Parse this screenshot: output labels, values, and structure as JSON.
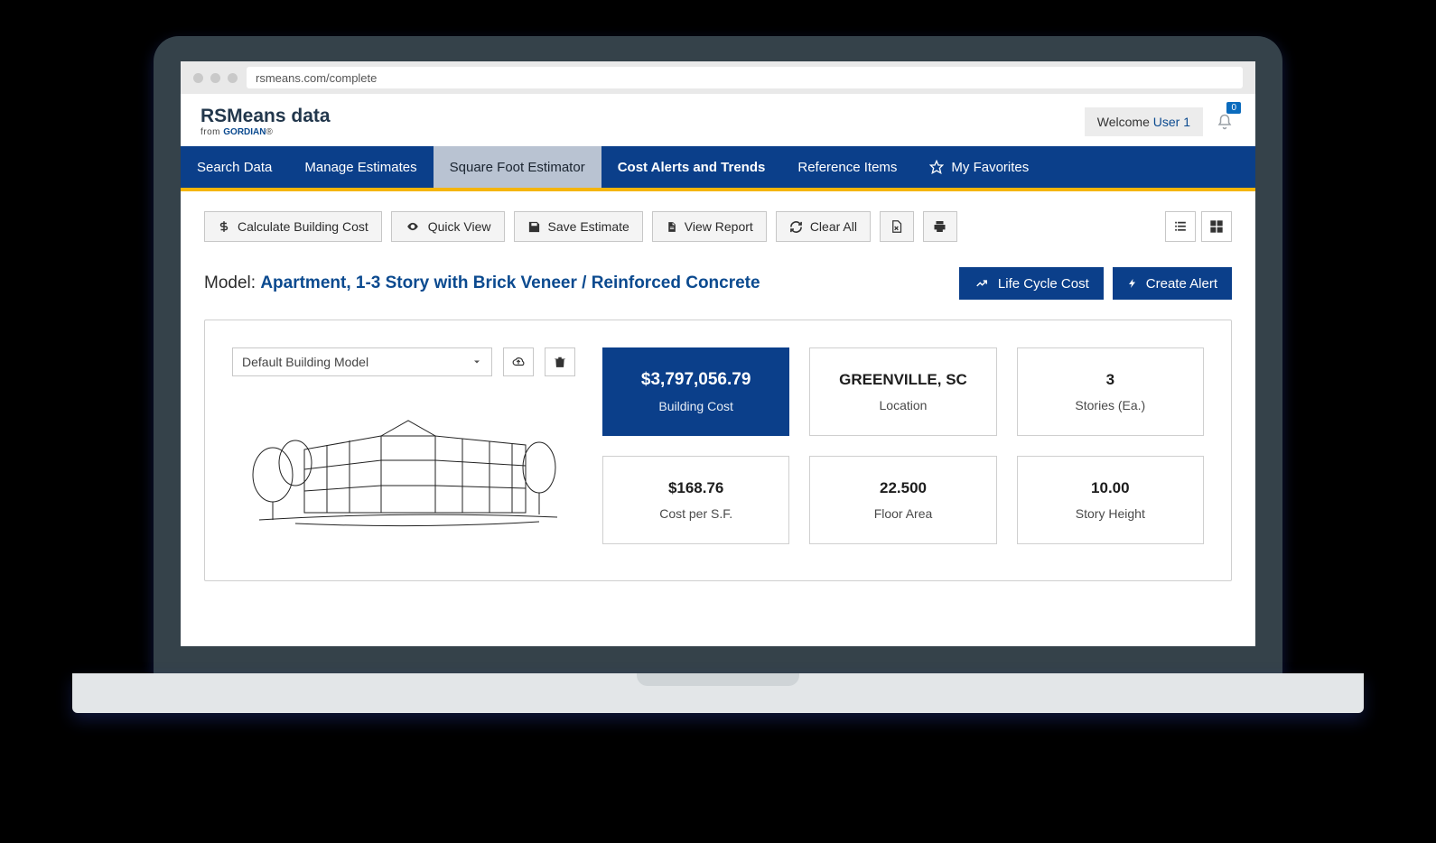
{
  "browser": {
    "url": "rsmeans.com/complete"
  },
  "header": {
    "logo_main": "RSMeans data",
    "logo_from": "from ",
    "logo_brand": "GORDIAN",
    "welcome": "Welcome ",
    "user": "User 1",
    "notifications": "0"
  },
  "nav": {
    "items": [
      {
        "label": "Search Data"
      },
      {
        "label": "Manage Estimates"
      },
      {
        "label": "Square Foot Estimator"
      },
      {
        "label": "Cost Alerts and Trends"
      },
      {
        "label": "Reference Items"
      },
      {
        "label": "My Favorites"
      }
    ]
  },
  "toolbar": {
    "calculate": "Calculate Building Cost",
    "quickview": "Quick View",
    "save": "Save Estimate",
    "report": "View Report",
    "clear": "Clear All"
  },
  "model": {
    "label": "Model: ",
    "name": "Apartment, 1-3 Story with Brick Veneer / Reinforced Concrete",
    "life_cycle": "Life Cycle Cost",
    "create_alert": "Create Alert"
  },
  "panel": {
    "dropdown": "Default Building Model",
    "cards": {
      "cost": {
        "value": "$3,797,056.79",
        "label": "Building Cost"
      },
      "location": {
        "value": "GREENVILLE, SC",
        "label": "Location"
      },
      "stories": {
        "value": "3",
        "label": "Stories (Ea.)"
      },
      "persf": {
        "value": "$168.76",
        "label": "Cost per S.F."
      },
      "area": {
        "value": "22.500",
        "label": "Floor Area"
      },
      "height": {
        "value": "10.00",
        "label": "Story Height"
      }
    }
  }
}
